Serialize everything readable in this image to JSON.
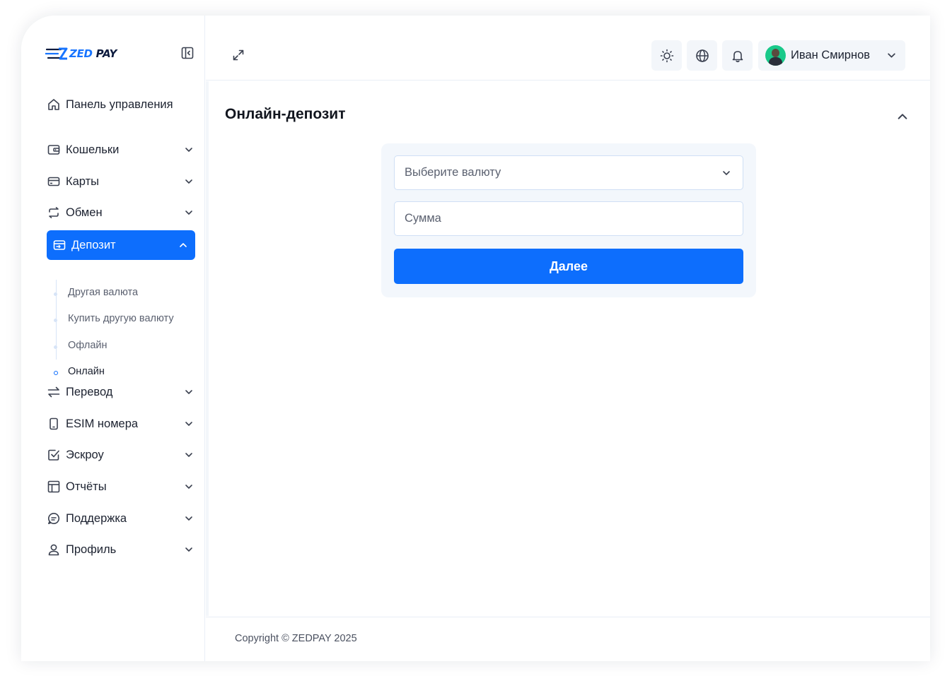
{
  "brand": {
    "name_part1": "ZED",
    "name_part2": "PAY",
    "primary_color": "#0d6efd"
  },
  "sidebar": {
    "items": [
      {
        "label": "Панель управления",
        "icon": "home-icon"
      },
      {
        "label": "Кошельки",
        "icon": "wallet-icon"
      },
      {
        "label": "Карты",
        "icon": "card-icon"
      },
      {
        "label": "Обмен",
        "icon": "exchange-icon"
      },
      {
        "label": "Депозит",
        "icon": "deposit-icon",
        "active": true
      },
      {
        "label": "Перевод",
        "icon": "transfer-icon"
      },
      {
        "label": "ESIM номера",
        "icon": "phone-icon"
      },
      {
        "label": "Эскроу",
        "icon": "checkbox-icon"
      },
      {
        "label": "Отчёты",
        "icon": "table-icon"
      },
      {
        "label": "Поддержка",
        "icon": "chat-icon"
      },
      {
        "label": "Профиль",
        "icon": "user-icon"
      }
    ],
    "deposit_submenu": [
      {
        "label": "Другая валюта"
      },
      {
        "label": "Купить другую валюту"
      },
      {
        "label": "Офлайн"
      },
      {
        "label": "Онлайн",
        "active": true
      }
    ]
  },
  "header": {
    "user_name": "Иван Смирнов",
    "icons": [
      "sun-icon",
      "globe-icon",
      "bell-icon"
    ]
  },
  "main": {
    "title": "Онлайн-депозит",
    "form": {
      "currency_placeholder": "Выберите валюту",
      "amount_placeholder": "Сумма",
      "submit_label": "Далее"
    }
  },
  "footer": {
    "copyright": "Copyright © ZEDPAY 2025"
  }
}
